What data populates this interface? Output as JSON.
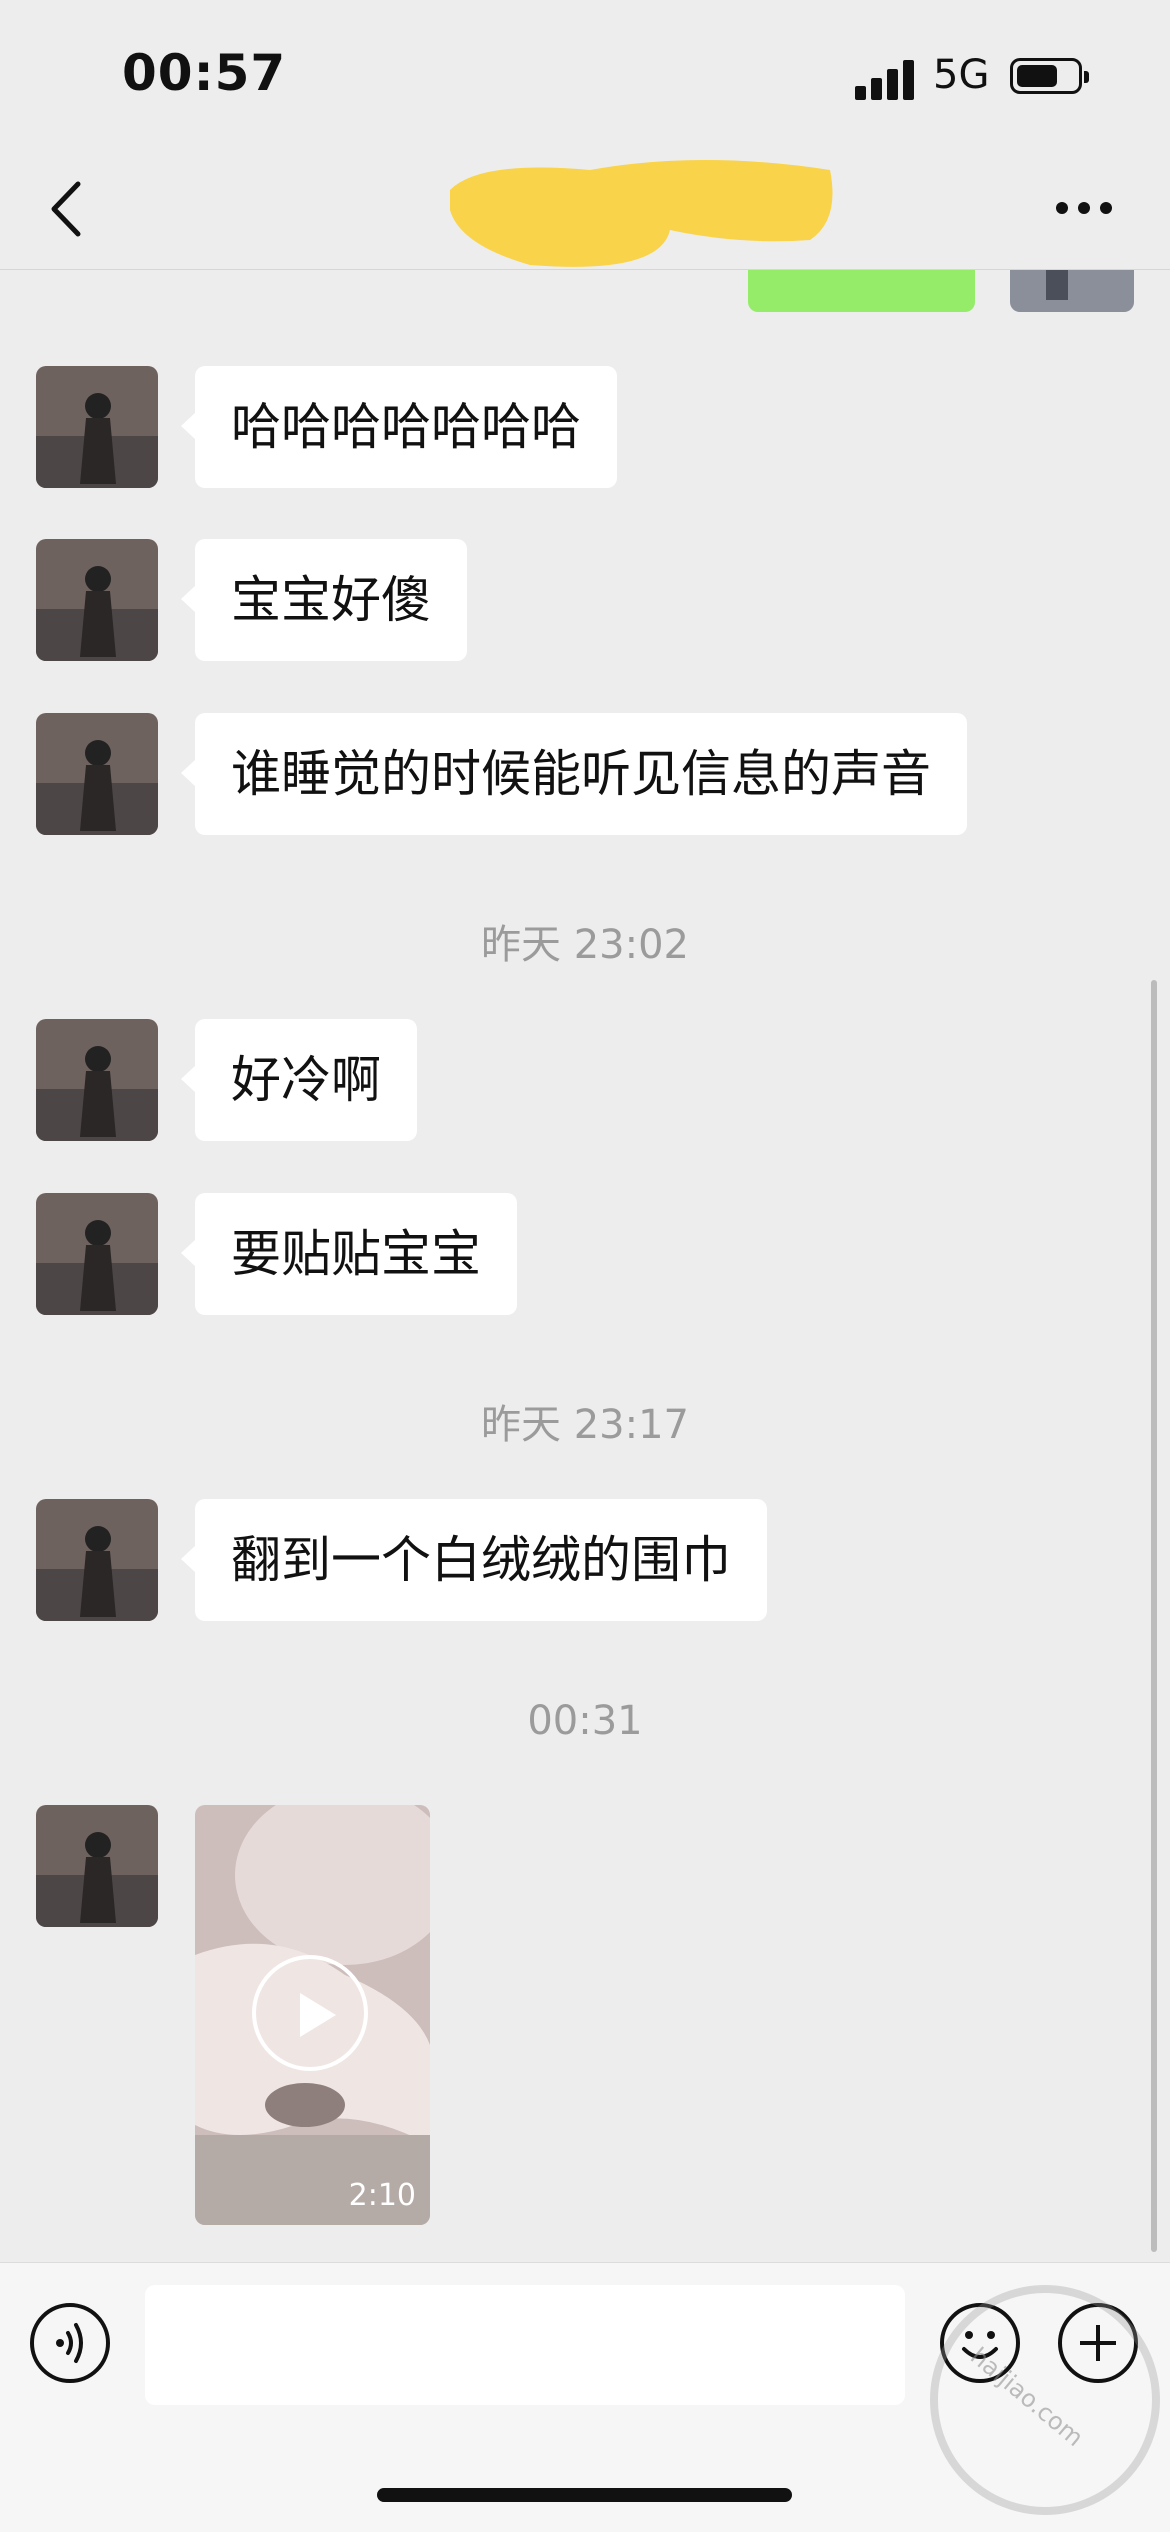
{
  "status_bar": {
    "time": "00:57",
    "network": "5G"
  },
  "messages": [
    {
      "type": "text",
      "text": "哈哈哈哈哈哈哈"
    },
    {
      "type": "text",
      "text": "宝宝好傻"
    },
    {
      "type": "text",
      "text": "谁睡觉的时候能听见信息的声音"
    },
    {
      "type": "time",
      "text": "昨天 23:02"
    },
    {
      "type": "text",
      "text": "好冷啊"
    },
    {
      "type": "text",
      "text": "要贴贴宝宝"
    },
    {
      "type": "time",
      "text": "昨天 23:17"
    },
    {
      "type": "text",
      "text": "翻到一个白绒绒的围巾"
    },
    {
      "type": "time",
      "text": "00:31"
    },
    {
      "type": "video",
      "duration": "2:10"
    }
  ],
  "icons": {
    "back": "chevron-left-icon",
    "more": "more-dots-icon",
    "play": "play-icon",
    "voice": "voice-icon",
    "emoji": "emoji-icon",
    "plus": "plus-icon"
  },
  "colors": {
    "background": "#ededed",
    "incoming_bubble": "#ffffff",
    "outgoing_bubble": "#95ec69",
    "timestamp": "#9b9b9b"
  }
}
